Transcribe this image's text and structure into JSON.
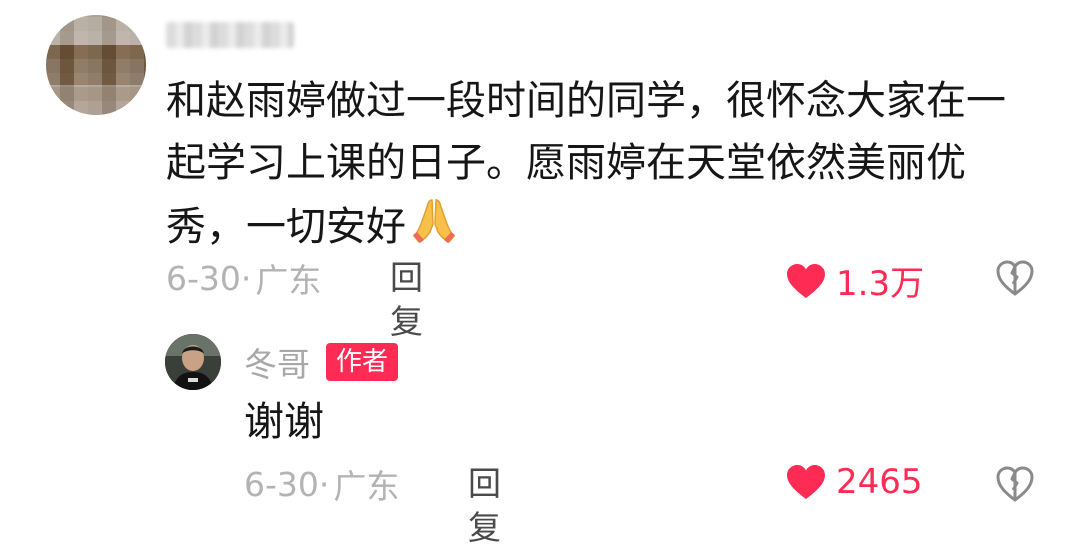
{
  "comment": {
    "text": "和赵雨婷做过一段时间的同学，很怀念大家在一起学习上课的日子。愿雨婷在天堂依然美丽优秀，一切安好",
    "emoji_icon": "folded-hands-icon",
    "date": "6-30·",
    "location": "广东",
    "reply_label": "回复",
    "like_count": "1.3万"
  },
  "reply": {
    "username": "冬哥",
    "badge": "作者",
    "text": "谢谢",
    "date": "6-30·",
    "location": "广东",
    "reply_label": "回复",
    "like_count": "2465"
  },
  "colors": {
    "accent": "#fe2c55",
    "meta": "#b3b3b3",
    "text": "#161616"
  }
}
